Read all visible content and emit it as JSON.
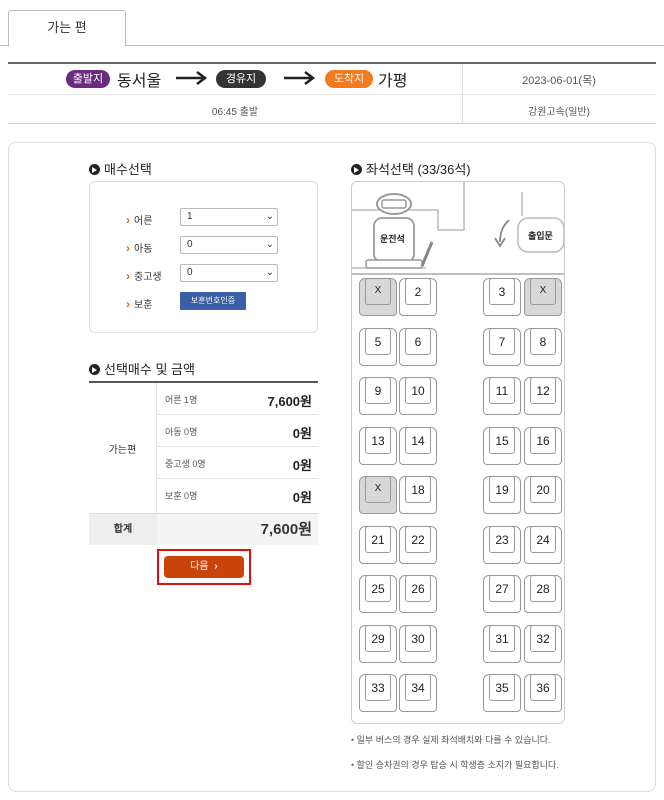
{
  "tab": {
    "label": "가는 편"
  },
  "route": {
    "departure_badge": "출발지",
    "departure": "동서울",
    "via_badge": "경유지",
    "arrival_badge": "도착지",
    "arrival": "가평",
    "date": "2023-06-01(목)",
    "departure_time": "06:45 출발",
    "company": "강원고속(일반)",
    "badge_colors": {
      "departure": "#6b2c80",
      "via": "#333333",
      "arrival": "#f27a20"
    }
  },
  "quantity": {
    "title": "매수선택",
    "rows": [
      {
        "label": "어른",
        "value": "1"
      },
      {
        "label": "아동",
        "value": "0"
      },
      {
        "label": "중고생",
        "value": "0"
      }
    ],
    "veteran_label": "보훈",
    "veteran_button": "보훈번호인증"
  },
  "price": {
    "title": "선택매수 및 금액",
    "trip_label": "가는편",
    "rows": [
      {
        "label": "어른 1명",
        "value": "7,600원"
      },
      {
        "label": "아동 0명",
        "value": "0원"
      },
      {
        "label": "중고생 0명",
        "value": "0원"
      },
      {
        "label": "보훈 0명",
        "value": "0원"
      }
    ],
    "total_label": "합계",
    "total_value": "7,600원"
  },
  "next_button": "다음",
  "seats": {
    "title": "좌석선택 (33/36석)",
    "driver_label": "운전석",
    "door_label": "출입문",
    "taken_mark": "X",
    "list": [
      {
        "id": "1",
        "taken": true
      },
      {
        "id": "2",
        "taken": false
      },
      {
        "id": "3",
        "taken": false
      },
      {
        "id": "4",
        "taken": true
      },
      {
        "id": "5",
        "taken": false
      },
      {
        "id": "6",
        "taken": false
      },
      {
        "id": "7",
        "taken": false
      },
      {
        "id": "8",
        "taken": false
      },
      {
        "id": "9",
        "taken": false
      },
      {
        "id": "10",
        "taken": false
      },
      {
        "id": "11",
        "taken": false
      },
      {
        "id": "12",
        "taken": false
      },
      {
        "id": "13",
        "taken": false
      },
      {
        "id": "14",
        "taken": false
      },
      {
        "id": "15",
        "taken": false
      },
      {
        "id": "16",
        "taken": false
      },
      {
        "id": "17",
        "taken": true
      },
      {
        "id": "18",
        "taken": false
      },
      {
        "id": "19",
        "taken": false
      },
      {
        "id": "20",
        "taken": false
      },
      {
        "id": "21",
        "taken": false
      },
      {
        "id": "22",
        "taken": false
      },
      {
        "id": "23",
        "taken": false
      },
      {
        "id": "24",
        "taken": false
      },
      {
        "id": "25",
        "taken": false
      },
      {
        "id": "26",
        "taken": false
      },
      {
        "id": "27",
        "taken": false
      },
      {
        "id": "28",
        "taken": false
      },
      {
        "id": "29",
        "taken": false
      },
      {
        "id": "30",
        "taken": false
      },
      {
        "id": "31",
        "taken": false
      },
      {
        "id": "32",
        "taken": false
      },
      {
        "id": "33",
        "taken": false
      },
      {
        "id": "34",
        "taken": false
      },
      {
        "id": "35",
        "taken": false
      },
      {
        "id": "36",
        "taken": false
      }
    ]
  },
  "notes": [
    "일부 버스의 경우 실제 좌석배치와 다를 수 있습니다.",
    "할인 승차권의 경우 탑승 시 학생증 소지가 필요합니다."
  ]
}
